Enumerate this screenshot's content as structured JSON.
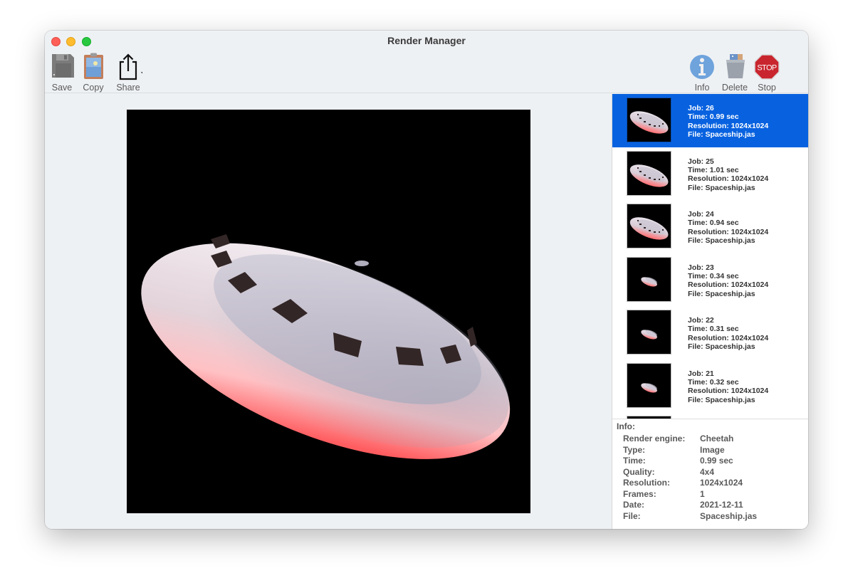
{
  "window": {
    "title": "Render Manager"
  },
  "toolbar": {
    "left": [
      {
        "id": "save",
        "label": "Save",
        "icon": "floppy-disk-icon"
      },
      {
        "id": "copy",
        "label": "Copy",
        "icon": "clipboard-image-icon"
      },
      {
        "id": "share",
        "label": "Share",
        "icon": "share-icon"
      }
    ],
    "right": [
      {
        "id": "info",
        "label": "Info",
        "icon": "info-icon"
      },
      {
        "id": "delete",
        "label": "Delete",
        "icon": "trash-icon"
      },
      {
        "id": "stop",
        "label": "Stop",
        "icon": "stop-sign-icon",
        "glyph": "STOP"
      }
    ]
  },
  "colors": {
    "selection": "#0862e0",
    "window_bg": "#eef1f4",
    "saucer_light": "#d8d8e6",
    "saucer_glow": "#ff5a5f",
    "window_dark": "#332626"
  },
  "jobs": [
    {
      "job_line": "Job: 26",
      "time_line": "Time: 0.99 sec",
      "res_line": "Resolution: 1024x1024",
      "file_line": "File: Spaceship.jas",
      "selected": true,
      "scale": 0.95
    },
    {
      "job_line": "Job: 25",
      "time_line": "Time: 1.01 sec",
      "res_line": "Resolution: 1024x1024",
      "file_line": "File: Spaceship.jas",
      "selected": false,
      "scale": 0.95
    },
    {
      "job_line": "Job: 24",
      "time_line": "Time: 0.94 sec",
      "res_line": "Resolution: 1024x1024",
      "file_line": "File: Spaceship.jas",
      "selected": false,
      "scale": 0.95
    },
    {
      "job_line": "Job: 23",
      "time_line": "Time: 0.34 sec",
      "res_line": "Resolution: 1024x1024",
      "file_line": "File: Spaceship.jas",
      "selected": false,
      "scale": 0.4
    },
    {
      "job_line": "Job: 22",
      "time_line": "Time: 0.31 sec",
      "res_line": "Resolution: 1024x1024",
      "file_line": "File: Spaceship.jas",
      "selected": false,
      "scale": 0.4
    },
    {
      "job_line": "Job: 21",
      "time_line": "Time: 0.32 sec",
      "res_line": "Resolution: 1024x1024",
      "file_line": "File: Spaceship.jas",
      "selected": false,
      "scale": 0.4
    }
  ],
  "info": {
    "heading": "Info:",
    "rows": [
      {
        "key": "Render engine:",
        "value": "Cheetah"
      },
      {
        "key": "Type:",
        "value": "Image"
      },
      {
        "key": "Time:",
        "value": "0.99 sec"
      },
      {
        "key": "Quality:",
        "value": "4x4"
      },
      {
        "key": "Resolution:",
        "value": "1024x1024"
      },
      {
        "key": "Frames:",
        "value": "1"
      },
      {
        "key": "Date:",
        "value": "2021-12-11"
      },
      {
        "key": "File:",
        "value": "Spaceship.jas"
      }
    ]
  }
}
